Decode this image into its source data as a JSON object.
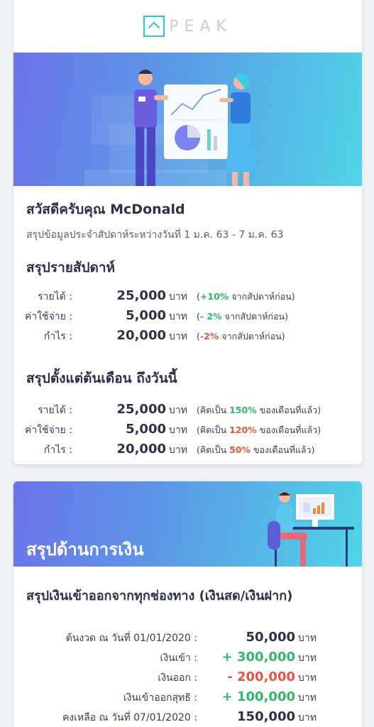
{
  "logo": {
    "text": "PEAK"
  },
  "greeting": {
    "title": "สวัสดีครับคุณ McDonald",
    "subtitle": "สรุปข้อมูลประจำสัปดาห์ระหว่างวันที่ 1 ม.ค. 63 - 7 ม.ค. 63"
  },
  "weekly": {
    "title": "สรุปรายสัปดาห์",
    "rows": [
      {
        "label": "รายได้ :",
        "value": "25,000",
        "unit": "บาท",
        "note_pre": "(",
        "note_hl": "+10%",
        "note_post": " จากสัปดาห์ก่อน)"
      },
      {
        "label": "ค่าใช้จ่าย :",
        "value": "5,000",
        "unit": "บาท",
        "note_pre": "(",
        "note_hl": "- 2%",
        "note_post": " จากสัปดาห์ก่อน)"
      },
      {
        "label": "กำไร :",
        "value": "20,000",
        "unit": "บาท",
        "note_pre": "(",
        "note_hl": "-2%",
        "note_post": " จากสัปดาห์ก่อน)"
      }
    ]
  },
  "monthly": {
    "title": "สรุปตั้งแต่ต้นเดือน ถึงวันนี้",
    "rows": [
      {
        "label": "รายได้ :",
        "value": "25,000",
        "unit": "บาท",
        "note_pre": "(คิดเป็น ",
        "note_hl": "150%",
        "note_post": " ของเดือนที่แล้ว)"
      },
      {
        "label": "ค่าใช้จ่าย :",
        "value": "5,000",
        "unit": "บาท",
        "note_pre": "(คิดเป็น ",
        "note_hl": "120%",
        "note_post": " ของเดือนที่แล้ว)"
      },
      {
        "label": "กำไร :",
        "value": "20,000",
        "unit": "บาท",
        "note_pre": "(คิดเป็น ",
        "note_hl": "50%",
        "note_post": " ของเดือนที่แล้ว)"
      }
    ]
  },
  "finance": {
    "banner_title": "สรุปด้านการเงิน",
    "cash_title": "สรุปเงินเข้าออกจากทุกช่องทาง (เงินสด/เงินฝาก)",
    "rows": [
      {
        "label": "ต้นงวด ณ วันที่ 01/01/2020 :",
        "value": "50,000",
        "unit": "บาท"
      },
      {
        "label": "เงินเข้า :",
        "value": "+ 300,000",
        "unit": "บาท"
      },
      {
        "label": "เงินออก :",
        "value": "- 200,000",
        "unit": "บาท"
      },
      {
        "label": "เงินเข้าออกสุทธิ :",
        "value": "+ 100,000",
        "unit": "บาท"
      },
      {
        "label": "คงเหลือ ณ วันที่ 07/01/2020 :",
        "value": "150,000",
        "unit": "บาท"
      }
    ]
  },
  "colors": {
    "accent_green": "#2fb869",
    "accent_red": "#e8553b",
    "logo_cyan": "#2cc5e0",
    "banner_start": "#6b73ea",
    "banner_end": "#4fd6e6"
  },
  "icons": [
    "peak-logo-icon",
    "presentation-illustration",
    "desk-worker-illustration"
  ]
}
